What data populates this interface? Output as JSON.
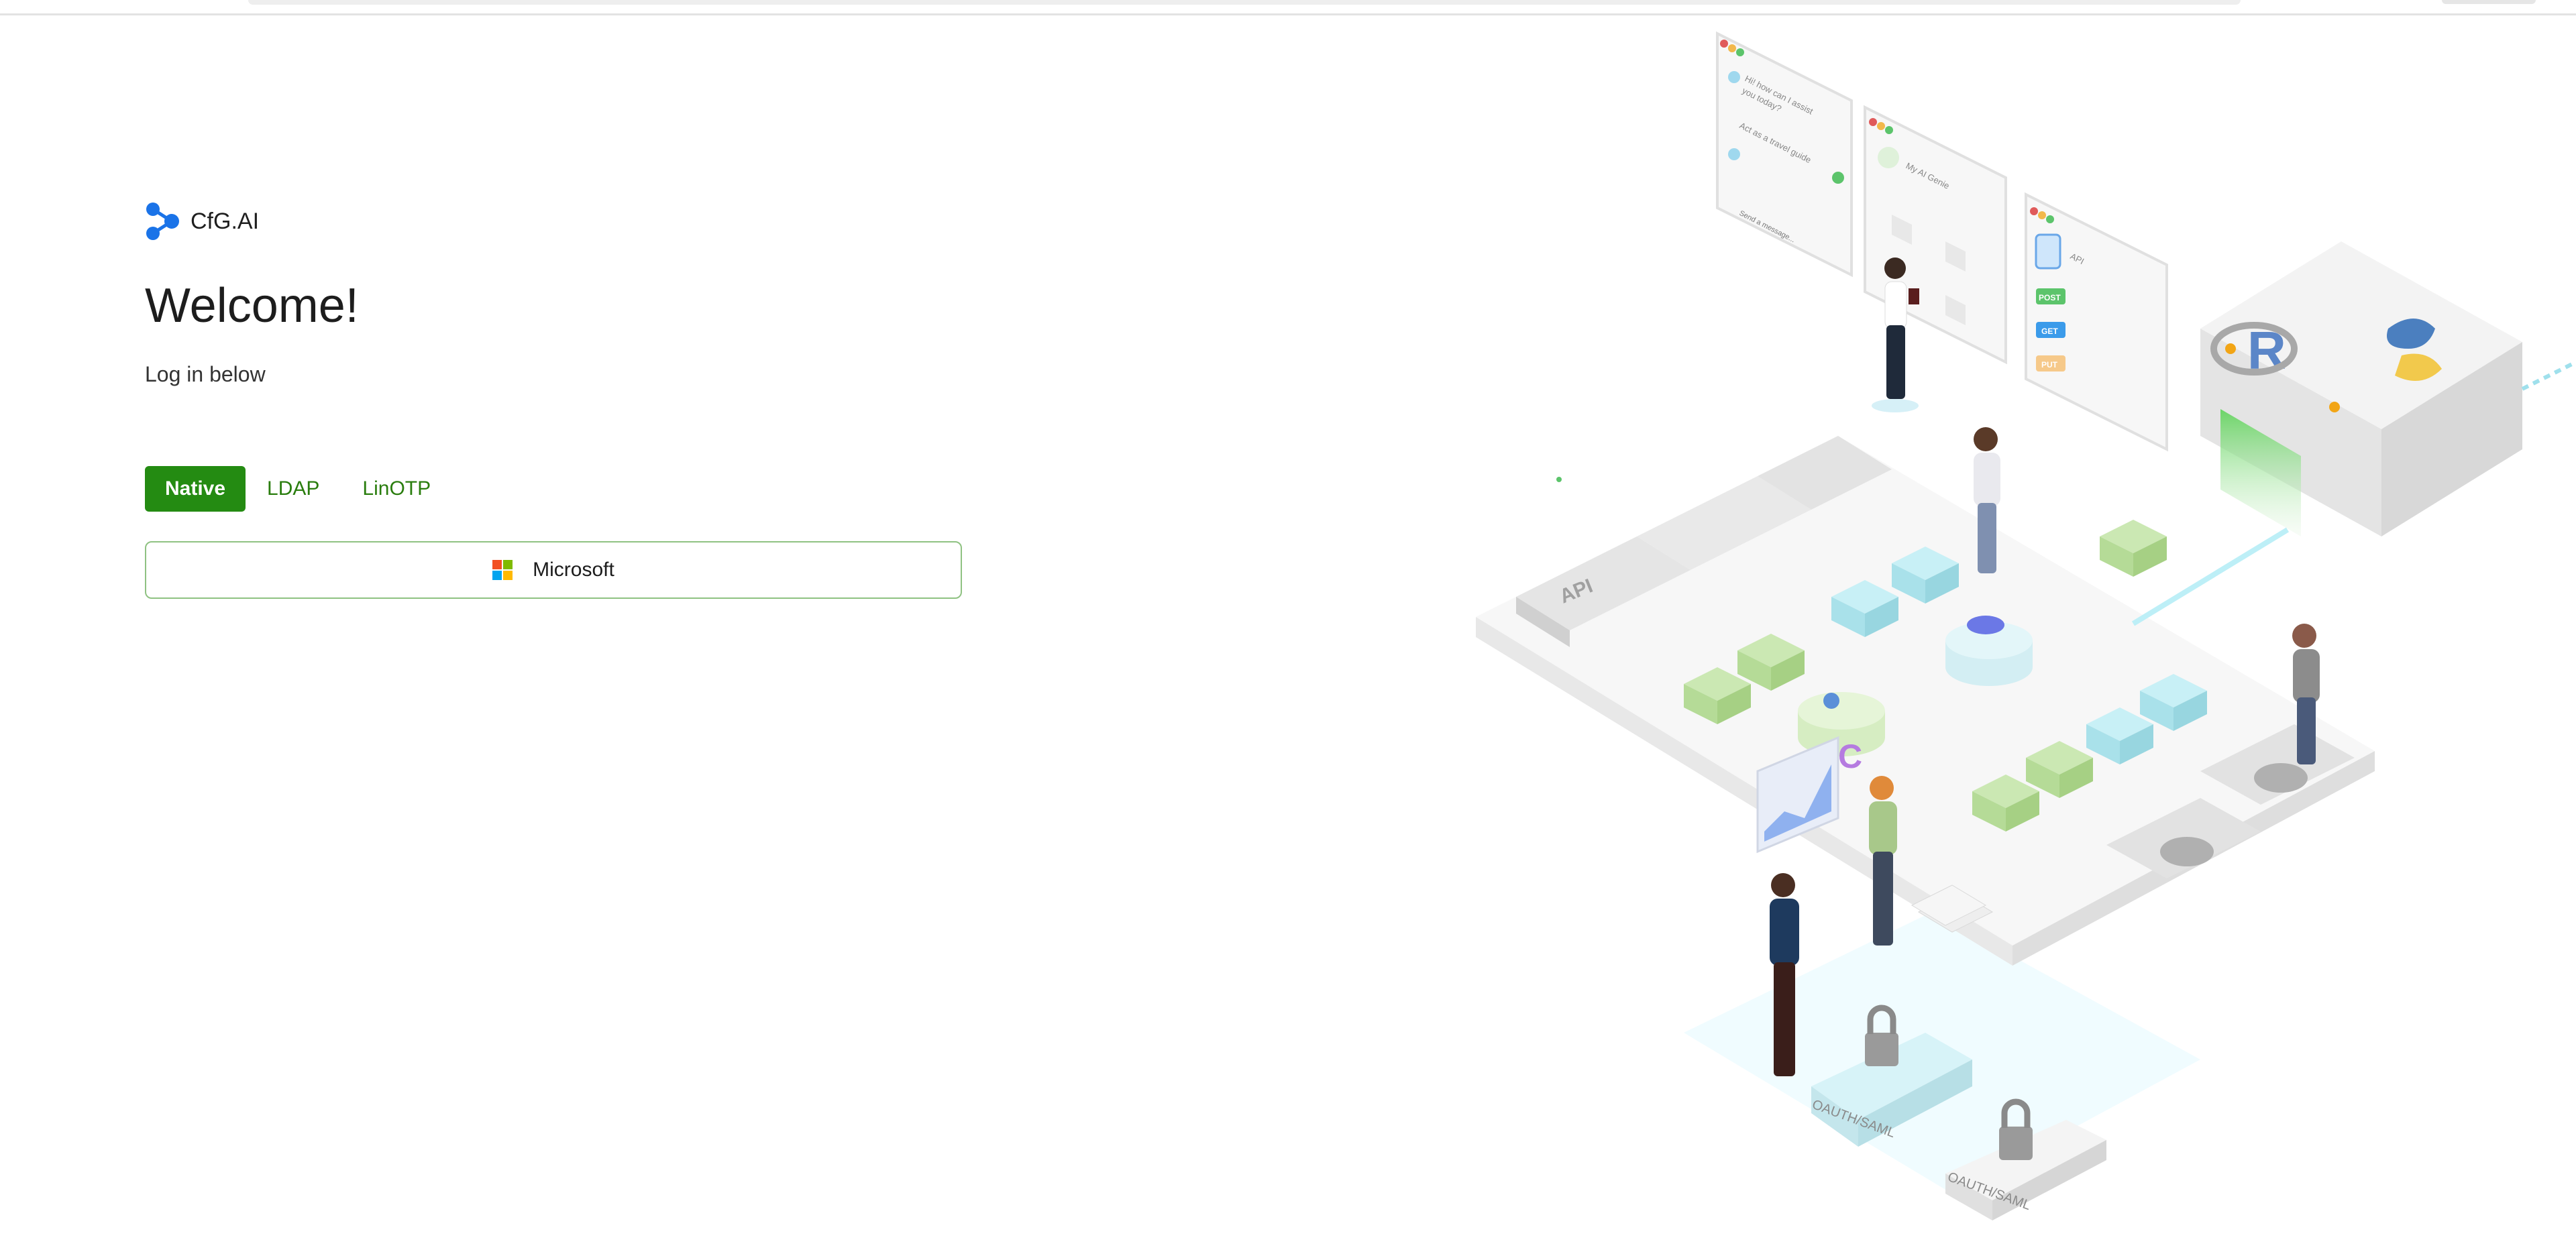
{
  "brand": {
    "name": "CfG.AI"
  },
  "login": {
    "title": "Welcome!",
    "subtitle": "Log in below",
    "tabs": [
      {
        "label": "Native",
        "active": true
      },
      {
        "label": "LDAP",
        "active": false
      },
      {
        "label": "LinOTP",
        "active": false
      }
    ],
    "sso_button": {
      "label": "Microsoft",
      "icon": "microsoft-logo-icon"
    }
  },
  "illustration": {
    "chat_card": {
      "line1": "Hi! how can I assist",
      "line2": "you today?",
      "line3": "Act as a travel guide",
      "input": "Send a message..."
    },
    "genie_card": {
      "title": "My AI Genie"
    },
    "api_card": {
      "title": "API",
      "methods": [
        "POST",
        "GET",
        "PUT"
      ]
    },
    "platform_tiles": [
      "API"
    ],
    "lock_labels": [
      "OAUTH/SAML",
      "OAUTH/SAML"
    ]
  },
  "colors": {
    "accent": "#248b12",
    "accent_text": "#2a7d0e",
    "brand_blue": "#1a73e8",
    "ms_red": "#f25022",
    "ms_green": "#7fba00",
    "ms_blue": "#00a4ef",
    "ms_yellow": "#ffb900"
  }
}
